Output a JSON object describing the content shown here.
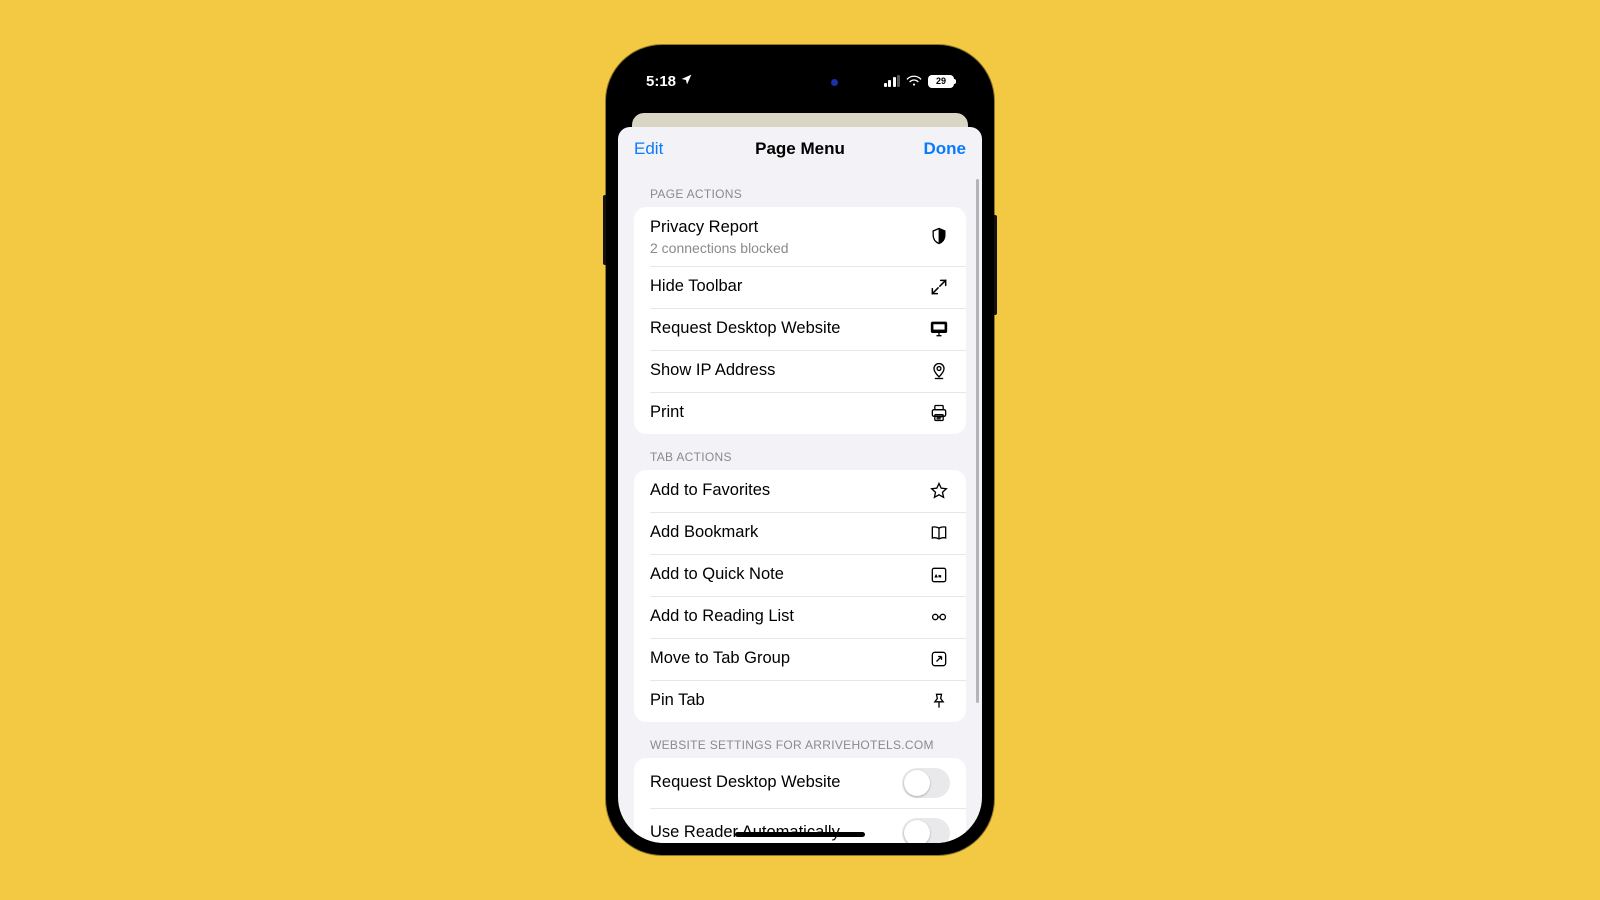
{
  "status": {
    "time": "5:18",
    "battery_pct": "29"
  },
  "sheet": {
    "edit": "Edit",
    "title": "Page Menu",
    "done": "Done"
  },
  "sections": {
    "page_actions_header": "PAGE ACTIONS",
    "tab_actions_header": "TAB ACTIONS",
    "website_settings_header": "WEBSITE SETTINGS FOR ARRIVEHOTELS.COM"
  },
  "page_actions": {
    "privacy_report": {
      "label": "Privacy Report",
      "sub": "2 connections blocked"
    },
    "hide_toolbar": {
      "label": "Hide Toolbar"
    },
    "request_desktop": {
      "label": "Request Desktop Website"
    },
    "show_ip": {
      "label": "Show IP Address"
    },
    "print": {
      "label": "Print"
    }
  },
  "tab_actions": {
    "add_favorites": {
      "label": "Add to Favorites"
    },
    "add_bookmark": {
      "label": "Add Bookmark"
    },
    "add_quick_note": {
      "label": "Add to Quick Note"
    },
    "add_reading_list": {
      "label": "Add to Reading List"
    },
    "move_tab_group": {
      "label": "Move to Tab Group"
    },
    "pin_tab": {
      "label": "Pin Tab"
    }
  },
  "website_settings": {
    "request_desktop": {
      "label": "Request Desktop Website",
      "on": false
    },
    "reader_auto": {
      "label": "Use Reader Automatically",
      "on": false
    }
  }
}
